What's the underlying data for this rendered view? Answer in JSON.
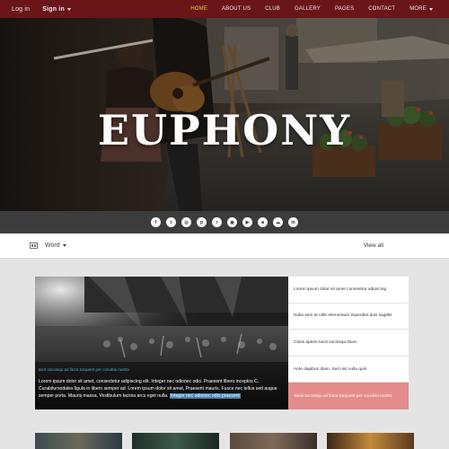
{
  "auth": {
    "login": "Log in",
    "signin": "Sign in"
  },
  "nav": {
    "items": [
      "HOME",
      "ABOUT US",
      "CLUB",
      "GALLERY",
      "PAGES",
      "CONTACT"
    ],
    "more": "MORE",
    "active": "HOME"
  },
  "hero": {
    "title": "EUPHONY"
  },
  "social": [
    "facebook-icon",
    "twitter-icon",
    "instagram-icon",
    "pinterest-icon",
    "rss-icon",
    "dribbble-icon",
    "youtube-icon",
    "tumblr-icon",
    "soundcloud-icon",
    "linkedin-icon"
  ],
  "subnav": {
    "category": "Word",
    "view_all": "View all"
  },
  "featured": {
    "tag": "tacit sociosqu ad litora torquent per conubia nostra",
    "excerpt": "Lorem ipsum dolor sit amet, consectetur adipiscing elit. Integer nec odionec odio. Praesent libero inceptos C. Curabitursodales ligula in libero semper ad. Lorem ipsum dolor sit amet, Praesent mauris. Fusce nec tellus sed augue semper porta. Mauris massa. Vestibulum lacinia arcu eget nulla.",
    "highlight": "Integer nec odionec odio praesent"
  },
  "sidelist": [
    "Lorem ipsum dolor sit amet consetetur adipscing",
    "Nulla sem at nibh elementum imperdiet duis sagittis",
    "Class aptent taciti sociosqu litora",
    "Ante dapibus diam. Sed nisi nulla quis",
    "Taciti sociosqu ad litora torquent per conubia nostra"
  ],
  "colors": {
    "topbar": "#6a1518",
    "active_nav": "#f2c94c",
    "accent_pink": "#e48c8c",
    "social_bar": "#3c3c3c"
  }
}
